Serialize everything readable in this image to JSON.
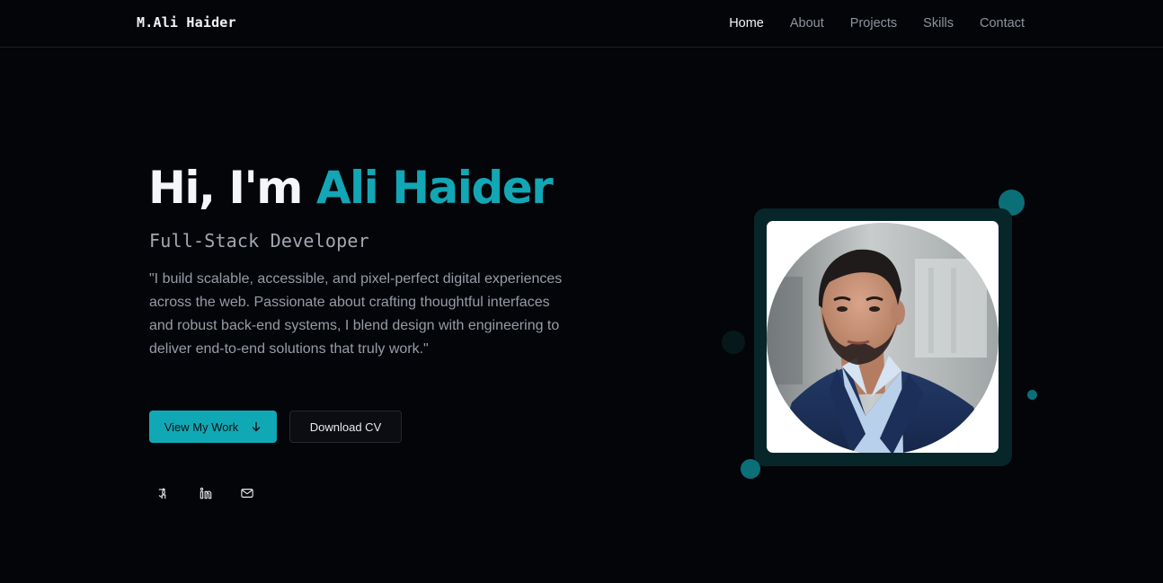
{
  "header": {
    "logo": "M.Ali Haider",
    "nav": [
      {
        "label": "Home",
        "active": true
      },
      {
        "label": "About",
        "active": false
      },
      {
        "label": "Projects",
        "active": false
      },
      {
        "label": "Skills",
        "active": false
      },
      {
        "label": "Contact",
        "active": false
      }
    ]
  },
  "hero": {
    "greeting": "Hi, I'm ",
    "name": "Ali Haider",
    "role": "Full-Stack Developer",
    "bio": "\"I build scalable, accessible, and pixel-perfect digital experiences across the web. Passionate about crafting thoughtful interfaces and robust back-end systems, I blend design with engineering to deliver end-to-end solutions that truly work.\"",
    "primary_button": "View My Work",
    "secondary_button": "Download CV"
  },
  "social": [
    {
      "icon": "github-icon"
    },
    {
      "icon": "linkedin-icon"
    },
    {
      "icon": "mail-icon"
    }
  ],
  "colors": {
    "background": "#040509",
    "accent": "#13a6b4",
    "frame": "#062629",
    "dots": "#0b6f78"
  }
}
